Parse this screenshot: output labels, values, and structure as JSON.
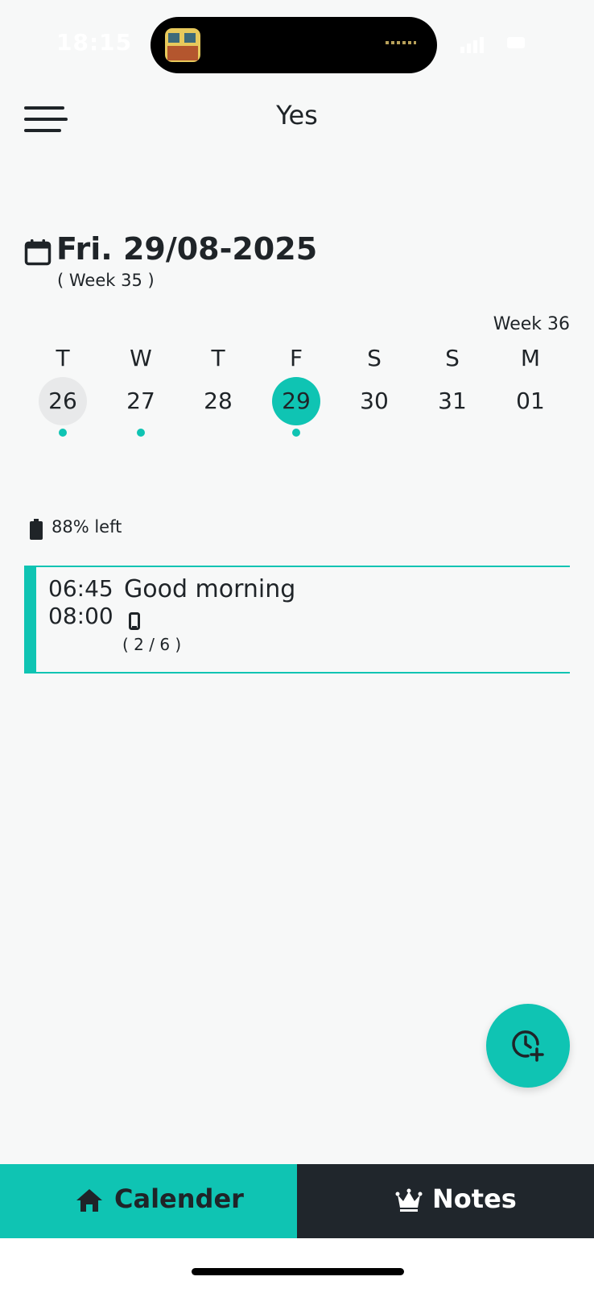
{
  "status_bar": {
    "time": "18:15"
  },
  "header": {
    "title": "Yes"
  },
  "date_header": {
    "date": "Fri. 29/08-2025",
    "week": "( Week 35 )",
    "next_week_label": "Week 36"
  },
  "week_strip": {
    "days": [
      {
        "letter": "T",
        "number": "26",
        "state": "today",
        "has_event": true
      },
      {
        "letter": "W",
        "number": "27",
        "state": "normal",
        "has_event": true
      },
      {
        "letter": "T",
        "number": "28",
        "state": "normal",
        "has_event": false
      },
      {
        "letter": "F",
        "number": "29",
        "state": "selected",
        "has_event": true
      },
      {
        "letter": "S",
        "number": "30",
        "state": "normal",
        "has_event": false
      },
      {
        "letter": "S",
        "number": "31",
        "state": "normal",
        "has_event": false
      },
      {
        "letter": "M",
        "number": "01",
        "state": "normal",
        "has_event": false
      }
    ]
  },
  "battery": {
    "text": "88% left"
  },
  "events": [
    {
      "start": "06:45",
      "end": "08:00",
      "title": "Good morning",
      "count": "( 2 / 6 )",
      "icon": "phone-icon"
    }
  ],
  "fab": {
    "icon": "clock-plus-icon"
  },
  "bottom_nav": {
    "calendar_label": "Calender",
    "notes_label": "Notes",
    "calendar_icon": "home-icon",
    "notes_icon": "crown-icon"
  },
  "colors": {
    "accent": "#0fc4b3",
    "dark": "#20262c",
    "background": "#f7f8f8"
  }
}
